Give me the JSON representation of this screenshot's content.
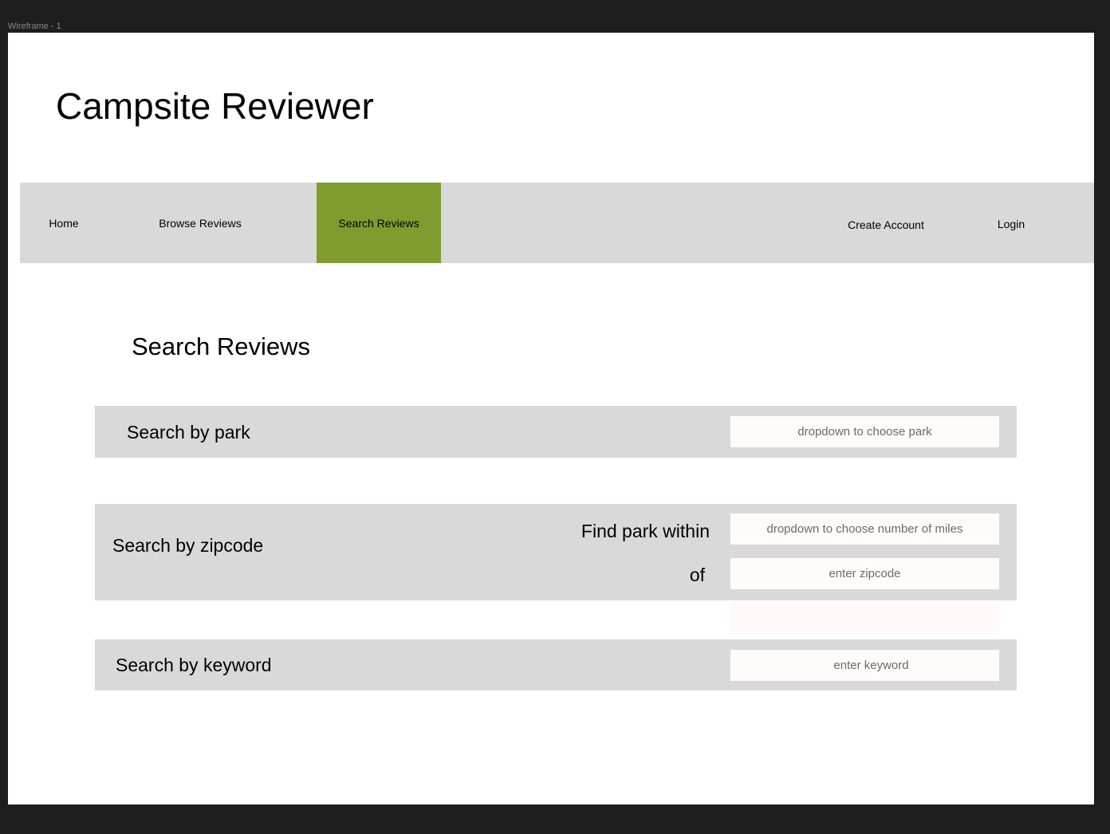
{
  "frame": {
    "label": "Wireframe - 1"
  },
  "app": {
    "title": "Campsite Reviewer"
  },
  "nav": {
    "items": [
      {
        "label": "Home"
      },
      {
        "label": "Browse Reviews"
      },
      {
        "label": "Search Reviews",
        "active": true
      },
      {
        "label": "Create Account"
      },
      {
        "label": "Login"
      }
    ],
    "active_color": "#7f9c2e",
    "bar_color": "#d9d9d9"
  },
  "search": {
    "title": "Search Reviews",
    "park": {
      "label": "Search by park",
      "dropdown_placeholder": "dropdown to choose park"
    },
    "zipcode": {
      "label": "Search by zipcode",
      "within_label": "Find park within",
      "miles_placeholder": "dropdown to choose number of miles",
      "of_label": "of",
      "zip_placeholder": "enter zipcode"
    },
    "keyword": {
      "label": "Search by keyword",
      "input_placeholder": "enter keyword"
    }
  }
}
